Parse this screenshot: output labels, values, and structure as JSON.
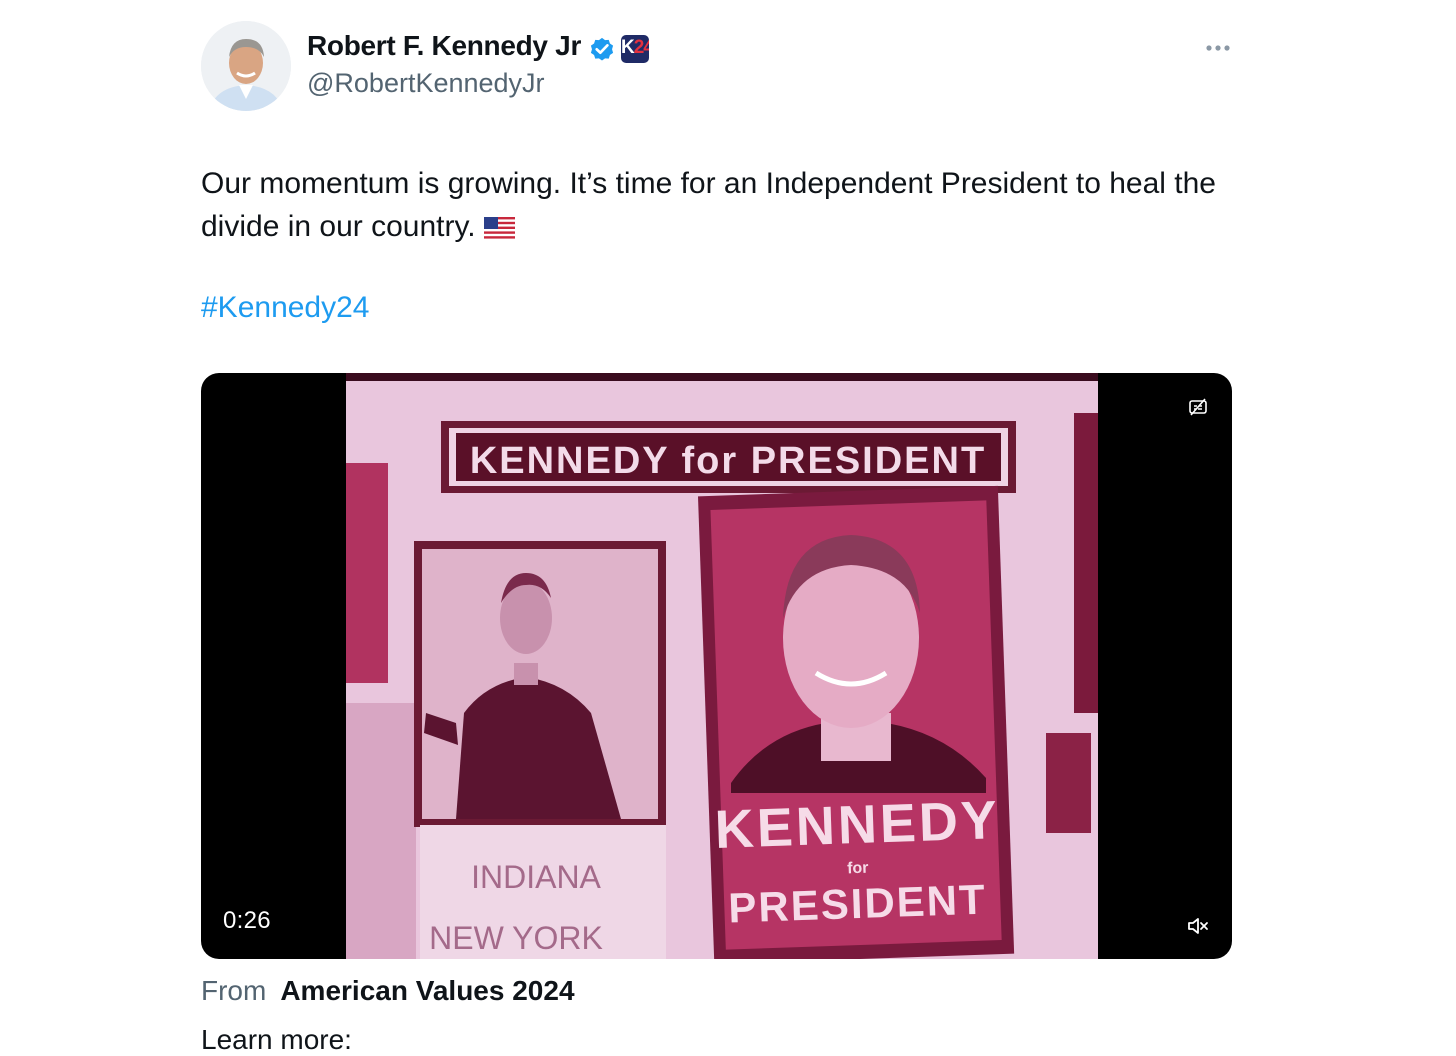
{
  "author": {
    "name": "Robert F. Kennedy Jr",
    "handle": "@RobertKennedyJr",
    "badge_text_a": "K",
    "badge_text_b": "24",
    "verified_color": "#1d9bf0",
    "badge_color": "#1f2a66"
  },
  "tweet": {
    "text": "Our momentum is growing. It’s time for an Independent President to heal the divide in our country.",
    "hashtag": "#Kennedy24",
    "link_color": "#1d9bf0"
  },
  "video": {
    "duration": "0:26",
    "banner_text": "KENNEDY for PRESIDENT",
    "poster_line1": "KENNEDY",
    "poster_line2": "for",
    "poster_line3": "PRESIDENT",
    "placard_text": "INDIANA",
    "placard_text2": "NEW YORK",
    "tint_color": "#c0406e"
  },
  "attribution": {
    "from_label": "From",
    "source": "American Values 2024"
  },
  "learn_more": "Learn more:"
}
